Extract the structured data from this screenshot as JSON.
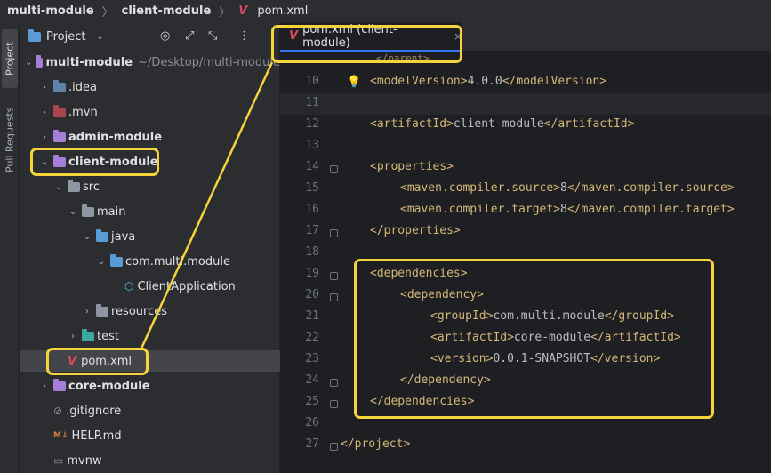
{
  "breadcrumb": {
    "project": "multi-module",
    "module": "client-module",
    "file": "pom.xml",
    "separator": "〉"
  },
  "toolstrip": {
    "project_tab": "Project",
    "pull_requests_tab": "Pull Requests"
  },
  "project_panel": {
    "title": "Project",
    "tree": [
      {
        "label": "multi-module",
        "hint": "~/Desktop/multi-module",
        "expanded": true,
        "icon": "module-folder-icon"
      },
      {
        "label": ".idea",
        "icon": "idea-folder-icon"
      },
      {
        "label": ".mvn",
        "icon": "folder-icon"
      },
      {
        "label": "admin-module",
        "icon": "module-folder-icon"
      },
      {
        "label": "client-module",
        "expanded": true,
        "icon": "module-folder-icon"
      },
      {
        "label": "src",
        "expanded": true,
        "icon": "source-folder-icon"
      },
      {
        "label": "main",
        "expanded": true,
        "icon": "folder-icon"
      },
      {
        "label": "java",
        "expanded": true,
        "icon": "java-source-folder-icon"
      },
      {
        "label": "com.multi.module",
        "icon": "package-icon"
      },
      {
        "label": "ClientApplication",
        "icon": "spring-class-icon"
      },
      {
        "label": "resources",
        "icon": "resources-folder-icon"
      },
      {
        "label": "test",
        "icon": "test-folder-icon"
      },
      {
        "label": "pom.xml",
        "selected": true,
        "icon": "maven-icon"
      },
      {
        "label": "core-module",
        "icon": "module-folder-icon"
      },
      {
        "label": ".gitignore",
        "icon": "gitignore-icon"
      },
      {
        "label": "HELP.md",
        "icon": "markdown-icon"
      },
      {
        "label": "mvnw",
        "icon": "terminal-icon"
      }
    ]
  },
  "editor": {
    "tab_label": "pom.xml (client-module)",
    "partial_top": "</parent>",
    "lines": [
      {
        "num": "10",
        "tag_open": "<modelVersion>",
        "text": "4.0.0",
        "tag_close": "</modelVersion>"
      },
      {
        "num": "11",
        "tag_open": "",
        "text": "",
        "tag_close": ""
      },
      {
        "num": "12",
        "tag_open": "<artifactId>",
        "text": "client-module",
        "tag_close": "</artifactId>"
      },
      {
        "num": "13",
        "tag_open": "",
        "text": "",
        "tag_close": ""
      },
      {
        "num": "14",
        "tag_open": "<properties>",
        "text": "",
        "tag_close": ""
      },
      {
        "num": "15",
        "tag_open": "<maven.compiler.source>",
        "text": "8",
        "tag_close": "</maven.compiler.source>"
      },
      {
        "num": "16",
        "tag_open": "<maven.compiler.target>",
        "text": "8",
        "tag_close": "</maven.compiler.target>"
      },
      {
        "num": "17",
        "tag_open": "</properties>",
        "text": "",
        "tag_close": ""
      },
      {
        "num": "18",
        "tag_open": "",
        "text": "",
        "tag_close": ""
      },
      {
        "num": "19",
        "tag_open": "<dependencies>",
        "text": "",
        "tag_close": ""
      },
      {
        "num": "20",
        "tag_open": "<dependency>",
        "text": "",
        "tag_close": ""
      },
      {
        "num": "21",
        "tag_open": "<groupId>",
        "text": "com.multi.module",
        "tag_close": "</groupId>"
      },
      {
        "num": "22",
        "tag_open": "<artifactId>",
        "text": "core-module",
        "tag_close": "</artifactId>"
      },
      {
        "num": "23",
        "tag_open": "<version>",
        "text": "0.0.1-SNAPSHOT",
        "tag_close": "</version>"
      },
      {
        "num": "24",
        "tag_open": "</dependency>",
        "text": "",
        "tag_close": ""
      },
      {
        "num": "25",
        "tag_open": "</dependencies>",
        "text": "",
        "tag_close": ""
      },
      {
        "num": "26",
        "tag_open": "",
        "text": "",
        "tag_close": ""
      },
      {
        "num": "27",
        "tag_open": "</project>",
        "text": "",
        "tag_close": ""
      }
    ]
  },
  "colors": {
    "annotation": "#f5d33a",
    "xml_tag": "#d5b778",
    "maven": "#d94a5f"
  }
}
